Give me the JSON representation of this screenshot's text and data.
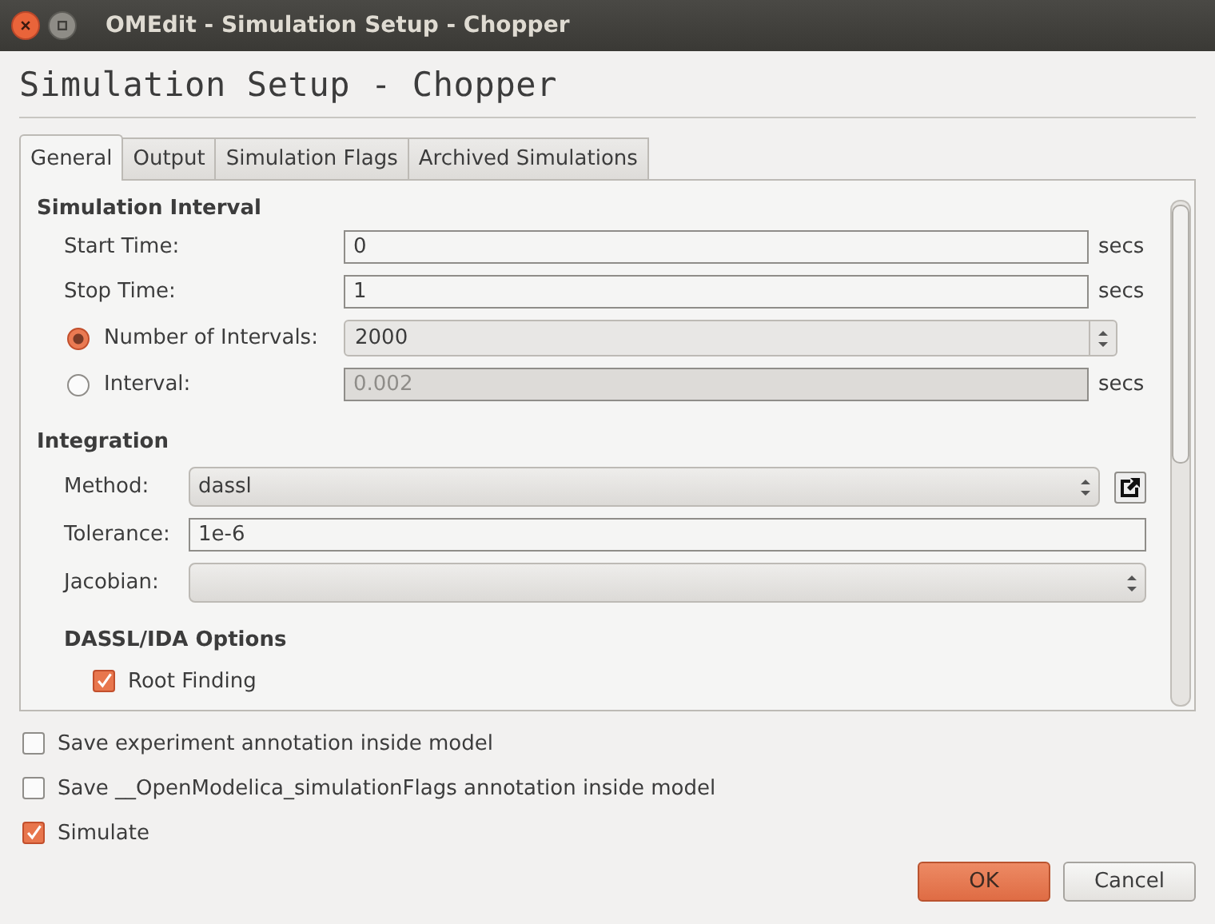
{
  "window": {
    "title": "OMEdit - Simulation Setup - Chopper"
  },
  "heading": "Simulation Setup - Chopper",
  "tabs": [
    {
      "label": "General",
      "selected": true
    },
    {
      "label": "Output",
      "selected": false
    },
    {
      "label": "Simulation Flags",
      "selected": false
    },
    {
      "label": "Archived Simulations",
      "selected": false
    }
  ],
  "simulation_interval": {
    "title": "Simulation Interval",
    "rows": [
      {
        "kind": "field",
        "label": "Start Time:",
        "value": "0",
        "unit": "secs"
      },
      {
        "kind": "field",
        "label": "Stop Time:",
        "value": "1",
        "unit": "secs"
      },
      {
        "kind": "radio-spin",
        "label": "Number of Intervals:",
        "value": "2000",
        "selected": true,
        "disabled": false
      },
      {
        "kind": "radio-field",
        "label": "Interval:",
        "value": "0.002",
        "unit": "secs",
        "selected": false,
        "disabled": true
      }
    ]
  },
  "integration": {
    "title": "Integration",
    "rows": [
      {
        "kind": "combo-icon",
        "label": "Method:",
        "value": "dassl"
      },
      {
        "kind": "field",
        "label": "Tolerance:",
        "value": "1e-6"
      },
      {
        "kind": "combo",
        "label": "Jacobian:"
      }
    ],
    "dassl_options": {
      "title": "DASSL/IDA Options",
      "items": [
        {
          "label": "Root Finding",
          "checked": true
        }
      ]
    }
  },
  "options": [
    {
      "label": "Save experiment annotation inside model",
      "checked": false
    },
    {
      "label": "Save __OpenModelica_simulationFlags annotation inside model",
      "checked": false
    },
    {
      "label": "Simulate",
      "checked": true
    }
  ],
  "buttons": [
    {
      "label": "OK",
      "kind": "primary"
    },
    {
      "label": "Cancel",
      "kind": "normal"
    }
  ]
}
